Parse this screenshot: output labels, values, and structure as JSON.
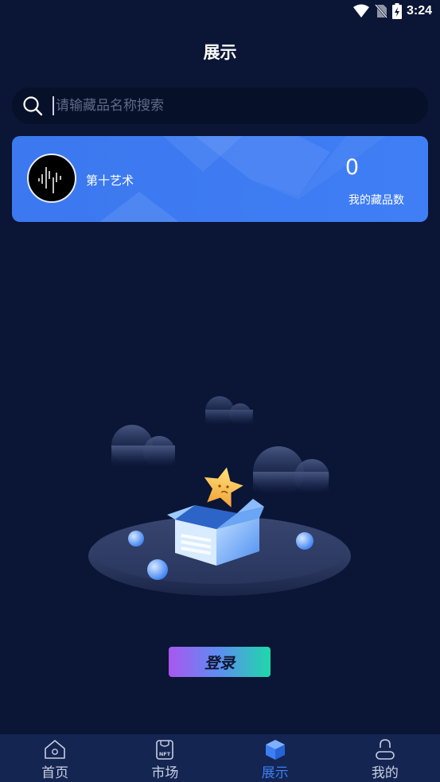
{
  "status_bar": {
    "time": "3:24"
  },
  "header": {
    "title": "展示"
  },
  "search": {
    "placeholder": "请输藏品名称搜索",
    "value": ""
  },
  "collection_card": {
    "brand_name": "第十艺术",
    "count_value": "0",
    "count_label": "我的藏品数"
  },
  "empty_state": {
    "login_label": "登录"
  },
  "bottom_nav": {
    "items": [
      {
        "label": "首页",
        "icon": "home-icon",
        "active": false
      },
      {
        "label": "市场",
        "icon": "nft-market-icon",
        "active": false
      },
      {
        "label": "展示",
        "icon": "cube-icon",
        "active": true
      },
      {
        "label": "我的",
        "icon": "profile-icon",
        "active": false
      }
    ]
  },
  "colors": {
    "background": "#0b1535",
    "accent": "#3b7ff2",
    "card": "#3f7ef5",
    "nav": "#142552"
  }
}
